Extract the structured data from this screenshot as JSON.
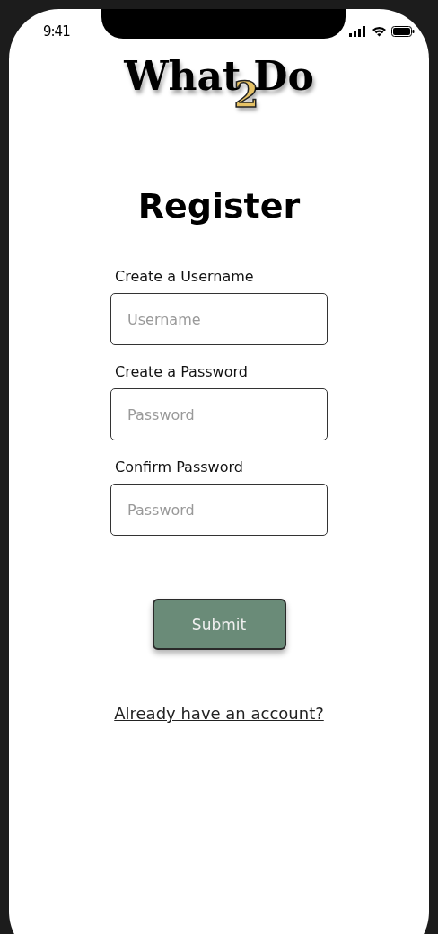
{
  "status_bar": {
    "time": "9:41"
  },
  "logo": {
    "parts": [
      "What",
      "2",
      "Do"
    ]
  },
  "title": "Register",
  "fields": [
    {
      "label": "Create a Username",
      "placeholder": "Username"
    },
    {
      "label": "Create a Password",
      "placeholder": "Password"
    },
    {
      "label": "Confirm Password",
      "placeholder": "Password"
    }
  ],
  "submit_button": "Submit",
  "login_link": "Already have an account?"
}
